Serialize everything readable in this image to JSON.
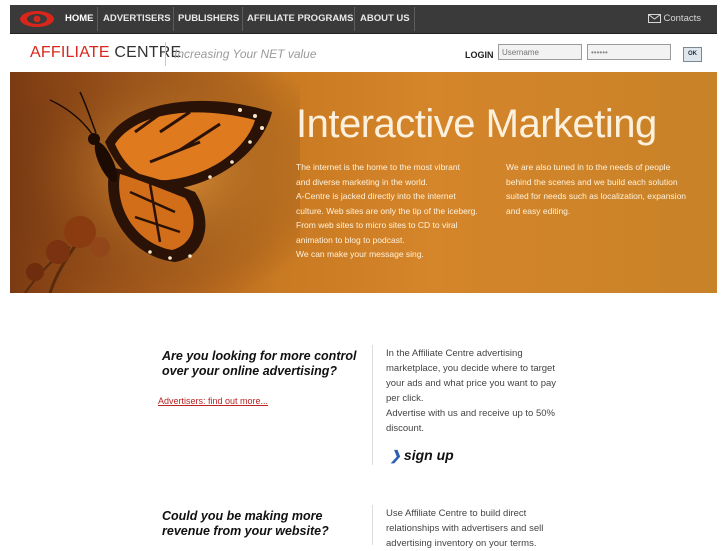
{
  "nav": {
    "items": [
      {
        "label": "HOME",
        "active": true
      },
      {
        "label": "ADVERTISERS"
      },
      {
        "label": "PUBLISHERS"
      },
      {
        "label": "AFFILIATE PROGRAMS"
      },
      {
        "label": "ABOUT US"
      }
    ],
    "contacts_label": "Contacts"
  },
  "brand": {
    "name_part1": "AFFILIATE",
    "name_part2": "CENTRE",
    "tagline": "Increasing Your NET value"
  },
  "login": {
    "label": "LOGIN",
    "username_placeholder": "Username",
    "password_value": "••••••",
    "ok_label": "OK"
  },
  "hero": {
    "title": "Interactive Marketing",
    "col1": [
      "The internet is the home to the most vibrant",
      "and diverse marketing in the world.",
      "A-Centre is jacked directly into the internet",
      "culture. Web sites are only the tip of the iceberg.",
      "From web sites to micro sites to CD to viral",
      "animation to blog to podcast.",
      "We can make your message sing."
    ],
    "col2": [
      "We are also tuned in to the needs of people",
      "behind the scenes and we build each solution",
      "suited for needs such as localization, expansion",
      "and easy editing."
    ]
  },
  "section1": {
    "title_line1": "Are you looking for more control",
    "title_line2": "over your online advertising?",
    "link": "Advertisers: find out more...",
    "desc": [
      "In the Affiliate Centre advertising",
      "marketplace, you decide where to target",
      "your ads and what price you want to pay",
      "per click.",
      "Advertise with us and receive up to 50%",
      "discount."
    ],
    "signup_label": "sign up"
  },
  "section2": {
    "title_line1": "Could you be making more",
    "title_line2": "revenue from your website?",
    "desc": [
      "Use Affiliate Centre to build direct",
      "relationships with advertisers and sell",
      "advertising inventory on your terms."
    ]
  },
  "colors": {
    "nav_bg": "#3a3a3a",
    "brand_red": "#d8261b",
    "hero_orange": "#d5852a",
    "link_red": "#b22222"
  }
}
